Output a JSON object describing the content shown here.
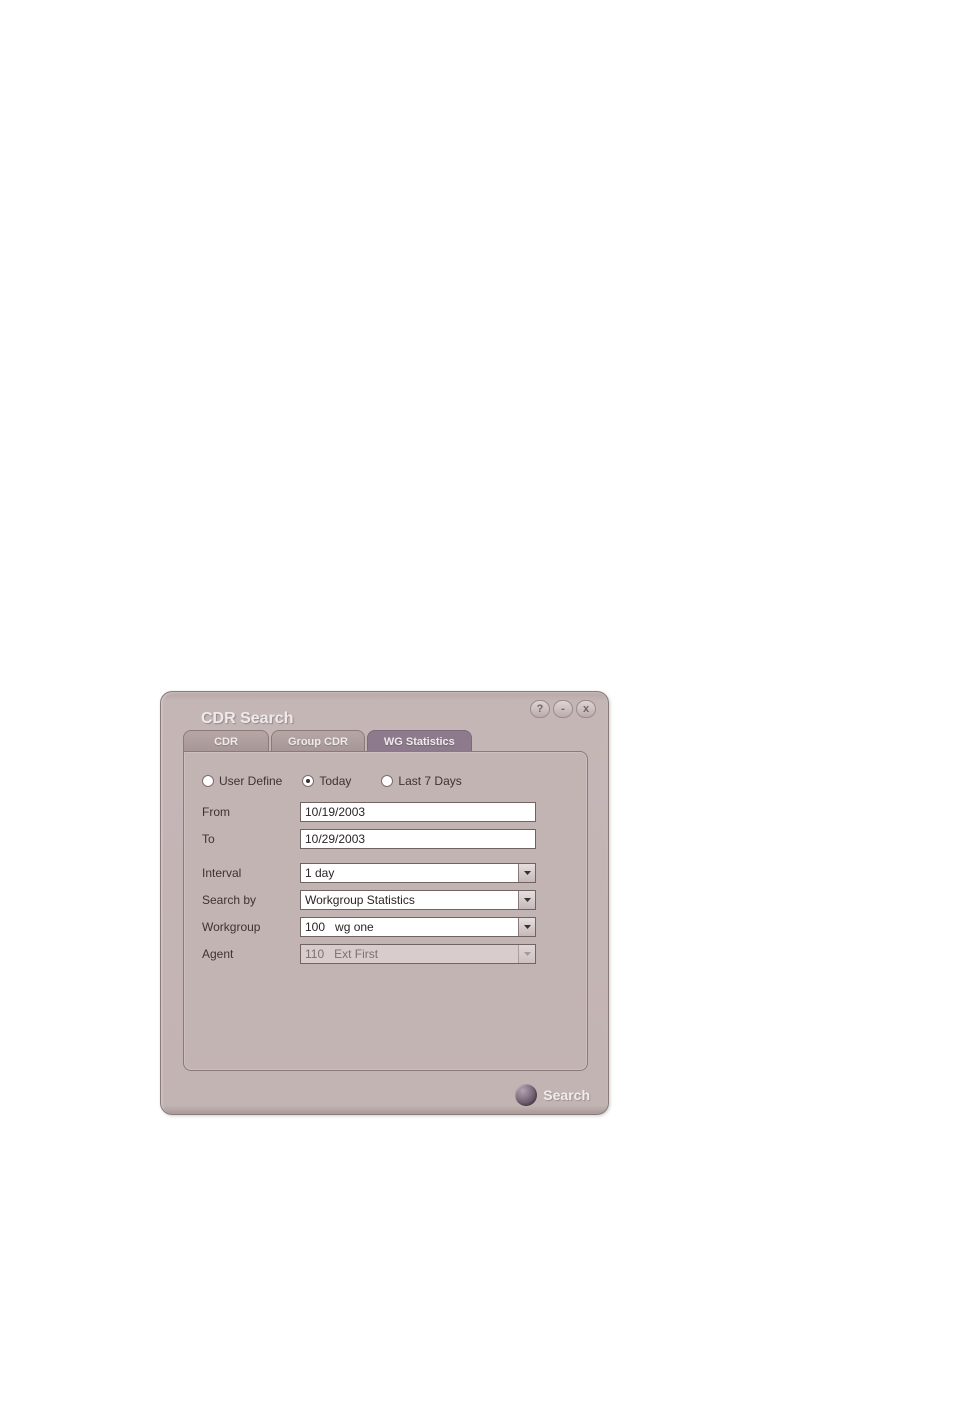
{
  "title": "CDR Search",
  "titlebar": {
    "help": "?",
    "minimize": "-",
    "close": "x"
  },
  "tabs": {
    "cdr": "CDR",
    "group_cdr": "Group CDR",
    "wg_statistics": "WG Statistics"
  },
  "radios": {
    "user_define": "User Define",
    "today": "Today",
    "last_7_days": "Last 7 Days"
  },
  "labels": {
    "from": "From",
    "to": "To",
    "interval": "Interval",
    "search_by": "Search by",
    "workgroup": "Workgroup",
    "agent": "Agent"
  },
  "fields": {
    "from": "10/19/2003",
    "to": "10/29/2003",
    "interval": "1 day",
    "search_by": "Workgroup Statistics",
    "workgroup": "100   wg one",
    "agent": "110   Ext First"
  },
  "footer": {
    "search": "Search"
  }
}
